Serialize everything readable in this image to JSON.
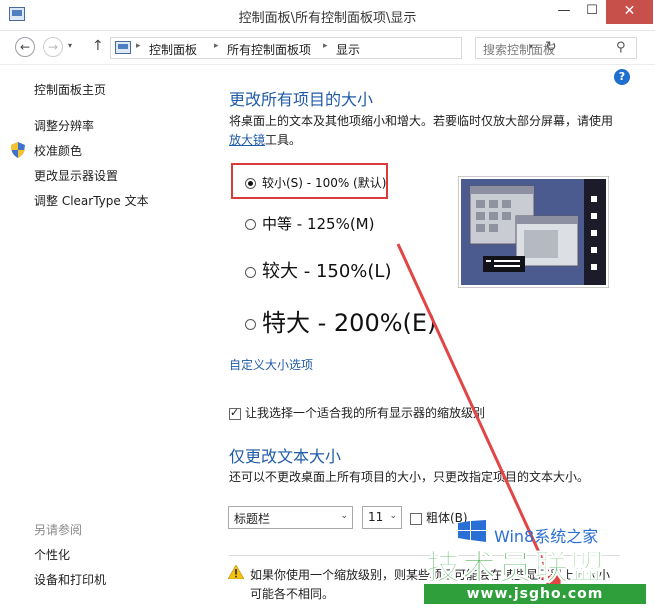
{
  "window": {
    "title": "控制面板\\所有控制面板项\\显示",
    "minimize": "—",
    "maximize": "☐",
    "close": "✕"
  },
  "nav": {
    "back": "←",
    "forward": "→",
    "recent": "▾",
    "up": "↑",
    "breadcrumb": [
      "控制面板",
      "所有控制面板项",
      "显示"
    ],
    "crumb_sep": "▸",
    "dropdown": "▾",
    "refresh": "↻",
    "search_placeholder": "搜索控制面板",
    "search_icon": "⚲"
  },
  "sidebar": {
    "items": [
      {
        "label": "控制面板主页"
      },
      {
        "label": "调整分辨率"
      },
      {
        "label": "校准颜色",
        "icon": "shield-icon"
      },
      {
        "label": "更改显示器设置"
      },
      {
        "label": "调整 ClearType 文本"
      }
    ],
    "see_also": "另请参阅",
    "see_also_items": [
      {
        "label": "个性化"
      },
      {
        "label": "设备和打印机"
      }
    ]
  },
  "main": {
    "help": "?",
    "heading": "更改所有项目的大小",
    "description_pre": "将桌面上的文本及其他项缩小和增大。若要临时仅放大部分屏幕，请使用",
    "magnifier_link": "放大镜",
    "description_post": "工具。",
    "options": [
      {
        "label": "较小(S) - 100% (默认)",
        "selected": true
      },
      {
        "label": "中等 - 125%(M)",
        "selected": false
      },
      {
        "label": "较大 - 150%(L)",
        "selected": false
      },
      {
        "label": "特大 - 200%(E)",
        "selected": false
      }
    ],
    "custom_link": "自定义大小选项",
    "scale_checkbox": {
      "label": "让我选择一个适合我的所有显示器的缩放级别",
      "checked": true
    },
    "text_heading": "仅更改文本大小",
    "text_description": "还可以不更改桌面上所有项目的大小，只更改指定项目的文本大小。",
    "item_select": {
      "value": "标题栏",
      "arrow": "⌄"
    },
    "size_select": {
      "value": "11",
      "arrow": "⌄"
    },
    "bold_checkbox": {
      "label": "粗体(B)",
      "checked": false
    },
    "warning": "如果你使用一个缩放级别，则某些项目可能会在某些显示器上的大小可能各不相同。"
  },
  "watermark": {
    "top": "Win8系统之家",
    "main": "技术员联盟",
    "url": "www.jsgho.com"
  },
  "colors": {
    "link": "#1f5ba8",
    "highlight": "#d93b3b",
    "arrow": "#e24545",
    "close_button": "#c7504a",
    "watermark_green": "#2fa63a"
  }
}
